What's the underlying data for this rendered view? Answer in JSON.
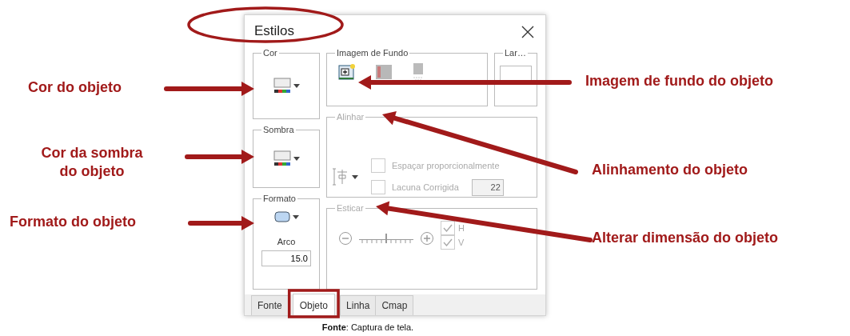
{
  "dialog": {
    "title": "Estilos",
    "color_group": {
      "label": "Cor"
    },
    "shadow_group": {
      "label": "Sombra"
    },
    "shape_group": {
      "label": "Formato",
      "arc_label": "Arco",
      "arc_value": "15.0"
    },
    "background_group": {
      "label": "Imagem de Fundo"
    },
    "width_group": {
      "label": "Lar…"
    },
    "align_group": {
      "label": "Alinhar",
      "disabled": true,
      "options": [
        {
          "label": "Espaçar proporcionalmente",
          "checked": false
        },
        {
          "label": "Lacuna Corrigida",
          "checked": false
        }
      ],
      "gap_value": "22"
    },
    "stretch_group": {
      "label": "Esticar",
      "disabled": true,
      "level": 0.5,
      "options": [
        {
          "label": "H",
          "checked": true
        },
        {
          "label": "V",
          "checked": true
        }
      ]
    },
    "tabs": [
      {
        "label": "Fonte",
        "selected": false
      },
      {
        "label": "Objeto",
        "selected": true
      },
      {
        "label": "Linha",
        "selected": false
      },
      {
        "label": "Cmap",
        "selected": false
      }
    ]
  },
  "annotations": [
    {
      "text": "Cor do objeto"
    },
    {
      "text": "Cor da sombra do objeto"
    },
    {
      "text": "Formato do objeto"
    },
    {
      "text": "Imagem de fundo do objeto"
    },
    {
      "text": "Alinhamento do objeto"
    },
    {
      "text": "Alterar dimensão do objeto"
    }
  ],
  "caption": "**Fonte**: Captura de tela."
}
